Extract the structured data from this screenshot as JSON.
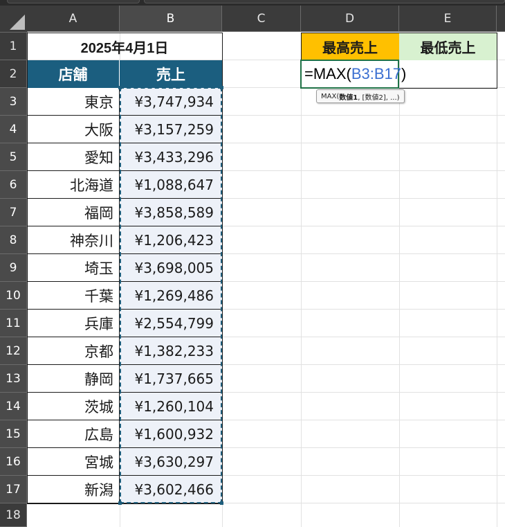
{
  "columns": [
    "A",
    "B",
    "C",
    "D",
    "E"
  ],
  "rows": [
    "1",
    "2",
    "3",
    "4",
    "5",
    "6",
    "7",
    "8",
    "9",
    "10",
    "11",
    "12",
    "13",
    "14",
    "15",
    "16",
    "17",
    "18"
  ],
  "sheet": {
    "date_title": "2025年4月1日",
    "header_store": "店舗",
    "header_sales": "売上",
    "header_max": "最高売上",
    "header_min": "最低売上",
    "formula_prefix": "=MAX(",
    "formula_ref": "B3:B17",
    "formula_suffix": ")",
    "tooltip_func": "MAX(",
    "tooltip_arg1": "数値1",
    "tooltip_rest": ", [数値2], ...)",
    "stores": [
      "東京",
      "大阪",
      "愛知",
      "北海道",
      "福岡",
      "神奈川",
      "埼玉",
      "千葉",
      "兵庫",
      "京都",
      "静岡",
      "茨城",
      "広島",
      "宮城",
      "新潟"
    ],
    "sales": [
      "¥3,747,934",
      "¥3,157,259",
      "¥3,433,296",
      "¥1,088,647",
      "¥3,858,589",
      "¥1,206,423",
      "¥3,698,005",
      "¥1,269,486",
      "¥2,554,799",
      "¥1,382,233",
      "¥1,737,665",
      "¥1,260,104",
      "¥1,600,932",
      "¥3,630,297",
      "¥3,602,466"
    ]
  },
  "colors": {
    "header_blue": "#1b5e7f",
    "header_gold": "#ffc000",
    "header_green": "#d8f1d0",
    "active_border": "#1e7145",
    "marquee": "#1f5f7d",
    "formula_ref": "#3b6fd1"
  }
}
